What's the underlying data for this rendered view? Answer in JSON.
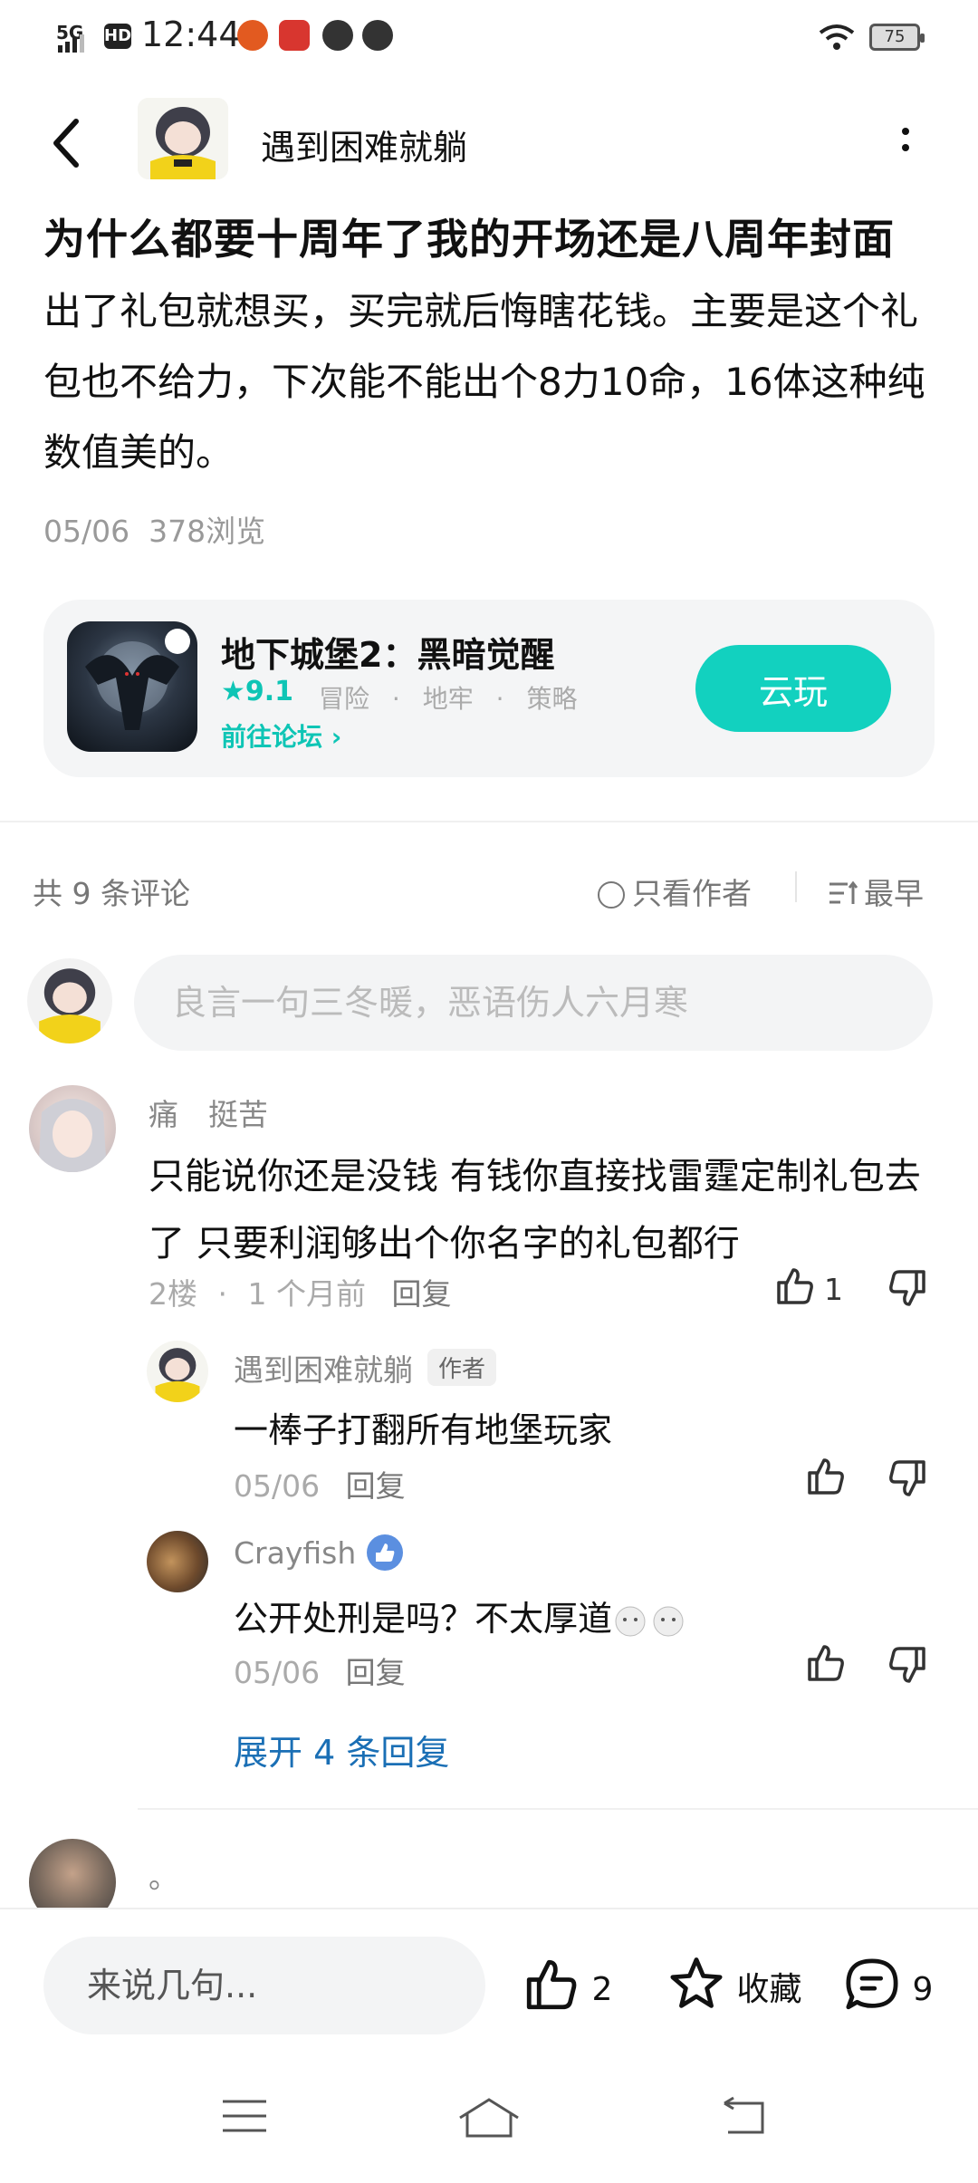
{
  "status_bar": {
    "signal": "5G",
    "hd": "HD",
    "time": "12:44",
    "battery": "75"
  },
  "header": {
    "username": "遇到困难就躺"
  },
  "post": {
    "title": "为什么都要十周年了我的开场还是八周年封面",
    "body": "出了礼包就想买，买完就后悔瞎花钱。主要是这个礼包也不给力，下次能不能出个8力10命，16体这种纯数值美的。",
    "date": "05/06",
    "views": "378浏览"
  },
  "game_card": {
    "name": "地下城堡2：黑暗觉醒",
    "rating": "9.1",
    "tags": [
      "冒险",
      "地牢",
      "策略"
    ],
    "forum_link": "前往论坛",
    "play_button": "云玩"
  },
  "comments_header": {
    "count_label": "共 9 条评论",
    "author_only": "只看作者",
    "sort": "最早"
  },
  "comment_input": {
    "placeholder": "良言一句三冬暖，恶语伤人六月寒"
  },
  "comments": [
    {
      "user": "痛　挺苦",
      "text": "只能说你还是没钱  有钱你直接找雷霆定制礼包去了 只要利润够出个你名字的礼包都行",
      "floor": "2楼",
      "time": "1 个月前",
      "reply_label": "回复",
      "likes": "1",
      "replies": [
        {
          "user": "遇到困难就躺",
          "tag": "作者",
          "text": "一棒子打翻所有地堡玩家",
          "date": "05/06",
          "reply_label": "回复"
        },
        {
          "user": "Crayfish",
          "text": "公开处刑是吗？不太厚道",
          "date": "05/06",
          "reply_label": "回复"
        }
      ],
      "expand_label": "展开 4 条回复"
    },
    {
      "user": "。"
    }
  ],
  "bottom_bar": {
    "input_placeholder": "来说几句...",
    "likes": "2",
    "favorite_label": "收藏",
    "comments": "9"
  },
  "colors": {
    "accent": "#12d1bf",
    "link": "#1a6fb5",
    "muted": "#999999"
  }
}
